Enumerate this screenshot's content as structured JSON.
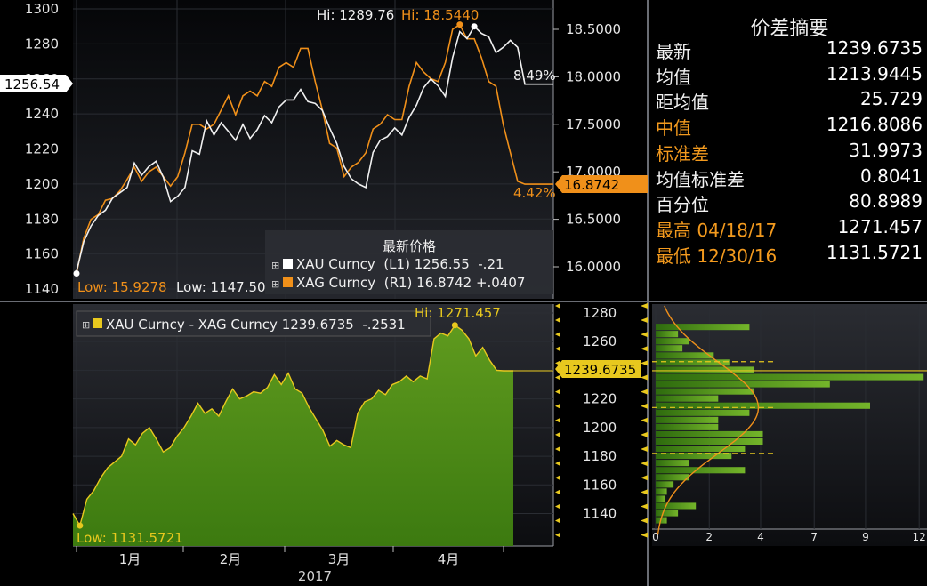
{
  "colors": {
    "background": "#000000",
    "xau_line": "#f0f0f0",
    "xag_line": "#f0901a",
    "spread_fill": "#4f8f16",
    "spread_line": "#e8c81e",
    "panel_top": "#1c1e23",
    "grid": "#2a2d33",
    "dashed_grid": "#3a3d44",
    "accent_yellow": "#e8c81e",
    "accent_orange": "#f0901a"
  },
  "top_chart": {
    "left_axis_ticks": [
      "1300",
      "1280",
      "1260",
      "1240",
      "1220",
      "1200",
      "1180",
      "1160",
      "1140"
    ],
    "right_axis_ticks": [
      "18.5000",
      "18.0000",
      "17.5000",
      "17.0000",
      "16.5000",
      "16.0000"
    ],
    "left_marker": "1256.54",
    "right_marker": "16.8742",
    "hi_xau": "Hi: 1289.76",
    "hi_xag": "Hi: 18.5440",
    "low_xag": "Low: 15.9278",
    "low_xau": "Low: 1147.50",
    "pct_xau": "8.49%",
    "pct_xag": "4.42%",
    "legend": {
      "title": "最新价格",
      "rows": [
        {
          "text": "XAU Curncy  (L1) 1256.55  -.21",
          "swatch": "#ffffff"
        },
        {
          "text": "XAG Curncy  (R1) 16.8742 +.0407",
          "swatch": "#f0901a"
        }
      ]
    }
  },
  "bottom_chart": {
    "legend": "XAU Curncy - XAG Curncy 1239.6735  -.2531",
    "hi_label": "Hi: 1271.457",
    "low_label": "Low: 1131.5721",
    "right_marker": "1239.6735",
    "right_axis_ticks": [
      "1280",
      "1260",
      "1240",
      "1220",
      "1200",
      "1180",
      "1160",
      "1140"
    ],
    "x_months": [
      "1月",
      "2月",
      "3月",
      "4月"
    ],
    "x_year": "2017"
  },
  "histogram": {
    "x_ticks": [
      "0",
      "2",
      "4",
      "7",
      "9",
      "12"
    ]
  },
  "summary": {
    "title": "价差摘要",
    "rows": [
      {
        "label": "最新",
        "value": "1239.6735",
        "color": "white"
      },
      {
        "label": "均值",
        "value": "1213.9445",
        "color": "white"
      },
      {
        "label": "距均值",
        "value": "25.729",
        "color": "white"
      },
      {
        "label": "中值",
        "value": "1216.8086",
        "color": "orange"
      },
      {
        "label": "标准差",
        "value": "31.9973",
        "color": "orange"
      },
      {
        "label": "均值标准差",
        "value": "0.8041",
        "color": "white"
      },
      {
        "label": "百分位",
        "value": "80.8989",
        "color": "white"
      },
      {
        "label": "最高 04/18/17",
        "value": "1271.457",
        "color": "orange"
      },
      {
        "label": "最低 12/30/16",
        "value": "1131.5721",
        "color": "orange"
      }
    ]
  },
  "chart_data": [
    {
      "type": "line",
      "title": "",
      "xlabel": "",
      "ylabel": "",
      "categories": [
        "1月",
        "2月",
        "3月",
        "4月"
      ],
      "ylim": [
        1137,
        1302
      ],
      "y2lim": [
        15.8,
        18.7
      ],
      "series": [
        {
          "name": "XAU Curncy",
          "axis": "left",
          "values": [
            1150,
            1167,
            1176,
            1182,
            1185,
            1192,
            1195,
            1198,
            1212,
            1205,
            1210,
            1213,
            1204,
            1190,
            1193,
            1198,
            1219,
            1217,
            1236,
            1228,
            1235,
            1230,
            1225,
            1234,
            1226,
            1231,
            1239,
            1235,
            1244,
            1248,
            1248,
            1254,
            1247,
            1246,
            1242,
            1232,
            1223,
            1210,
            1203,
            1200,
            1198,
            1218,
            1225,
            1227,
            1232,
            1228,
            1238,
            1245,
            1255,
            1260,
            1256,
            1250,
            1272,
            1287,
            1283,
            1290,
            1286,
            1284,
            1275,
            1278,
            1282,
            1278,
            1257,
            1257
          ]
        },
        {
          "name": "XAG Curncy",
          "axis": "right",
          "values": [
            15.93,
            16.3,
            16.5,
            16.55,
            16.7,
            16.72,
            16.8,
            16.92,
            17.05,
            16.9,
            17.0,
            17.05,
            16.95,
            16.85,
            16.95,
            17.2,
            17.5,
            17.5,
            17.45,
            17.5,
            17.65,
            17.8,
            17.6,
            17.8,
            17.85,
            17.8,
            17.95,
            17.9,
            18.1,
            18.15,
            18.1,
            18.3,
            18.3,
            17.95,
            17.65,
            17.3,
            17.25,
            16.95,
            17.05,
            17.1,
            17.2,
            17.45,
            17.5,
            17.6,
            17.55,
            17.55,
            17.9,
            18.15,
            18.05,
            17.98,
            17.95,
            18.15,
            18.5,
            18.55,
            18.4,
            18.4,
            18.2,
            17.95,
            17.9,
            17.5,
            17.2,
            16.9,
            16.87,
            16.87
          ]
        }
      ]
    },
    {
      "type": "area",
      "title": "",
      "categories": [
        "1月",
        "2月",
        "3月",
        "4月"
      ],
      "ylim": [
        1122,
        1284
      ],
      "series": [
        {
          "name": "XAU Curncy - XAG Curncy",
          "values": [
            1140,
            1131.57,
            1150,
            1156,
            1165,
            1172,
            1176,
            1180,
            1192,
            1188,
            1196,
            1200,
            1192,
            1183,
            1186,
            1194,
            1200,
            1208,
            1217,
            1210,
            1213,
            1208,
            1218,
            1227,
            1220,
            1222,
            1225,
            1224,
            1228,
            1237,
            1230,
            1238,
            1227,
            1224,
            1214,
            1206,
            1198,
            1187,
            1191,
            1188,
            1186,
            1210,
            1218,
            1220,
            1226,
            1223,
            1230,
            1232,
            1236,
            1232,
            1236,
            1234,
            1262,
            1266,
            1264,
            1271.46,
            1268,
            1262,
            1250,
            1256,
            1247,
            1240,
            1239.67,
            1239.67
          ]
        }
      ]
    },
    {
      "type": "bar",
      "title": "",
      "orientation": "horizontal",
      "xlim": [
        0,
        12
      ],
      "bins": [
        {
          "y": 1270,
          "count": 4.2
        },
        {
          "y": 1265,
          "count": 1.0
        },
        {
          "y": 1260,
          "count": 1.5
        },
        {
          "y": 1255,
          "count": 1.2
        },
        {
          "y": 1250,
          "count": 2.6
        },
        {
          "y": 1245,
          "count": 3.3
        },
        {
          "y": 1240,
          "count": 4.4
        },
        {
          "y": 1235,
          "count": 12.0
        },
        {
          "y": 1230,
          "count": 7.8
        },
        {
          "y": 1225,
          "count": 4.4
        },
        {
          "y": 1220,
          "count": 2.8
        },
        {
          "y": 1215,
          "count": 9.6
        },
        {
          "y": 1210,
          "count": 4.2
        },
        {
          "y": 1205,
          "count": 2.8
        },
        {
          "y": 1200,
          "count": 2.8
        },
        {
          "y": 1195,
          "count": 4.8
        },
        {
          "y": 1190,
          "count": 4.8
        },
        {
          "y": 1185,
          "count": 4.0
        },
        {
          "y": 1180,
          "count": 3.4
        },
        {
          "y": 1175,
          "count": 1.5
        },
        {
          "y": 1170,
          "count": 4.0
        },
        {
          "y": 1165,
          "count": 1.5
        },
        {
          "y": 1160,
          "count": 0.8
        },
        {
          "y": 1155,
          "count": 0.5
        },
        {
          "y": 1150,
          "count": 0.4
        },
        {
          "y": 1145,
          "count": 1.8
        },
        {
          "y": 1140,
          "count": 1.0
        },
        {
          "y": 1135,
          "count": 0.5
        }
      ]
    }
  ]
}
